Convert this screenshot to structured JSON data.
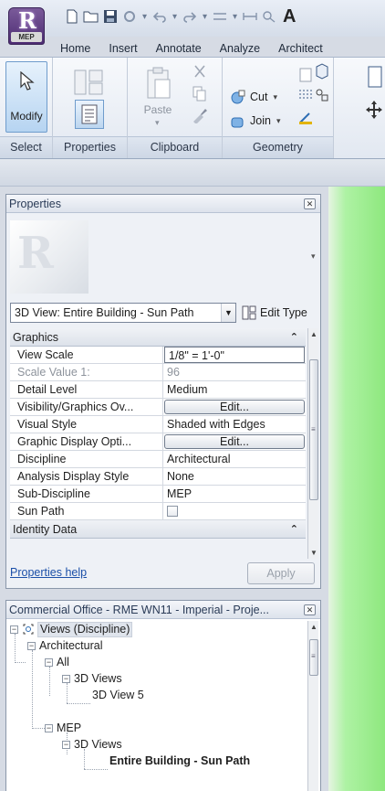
{
  "app": {
    "badge": "MEP",
    "qat_letter": "A"
  },
  "ribbon": {
    "tabs": [
      "Home",
      "Insert",
      "Annotate",
      "Analyze",
      "Architect"
    ],
    "panels": {
      "select": {
        "label": "Select",
        "modify": "Modify"
      },
      "properties": {
        "label": "Properties"
      },
      "clipboard": {
        "label": "Clipboard",
        "paste": "Paste"
      },
      "geometry": {
        "label": "Geometry",
        "cut": "Cut",
        "join": "Join"
      }
    }
  },
  "properties": {
    "title": "Properties",
    "type_selector": "3D View: Entire Building - Sun Path",
    "edit_type": "Edit Type",
    "groups": [
      {
        "name": "Graphics",
        "rows": [
          {
            "key": "View Scale",
            "value": "1/8\" = 1'-0\""
          },
          {
            "key": "Scale Value    1:",
            "value": "96"
          },
          {
            "key": "Detail Level",
            "value": "Medium"
          },
          {
            "key": "Visibility/Graphics Ov...",
            "value": "Edit..."
          },
          {
            "key": "Visual Style",
            "value": "Shaded with Edges"
          },
          {
            "key": "Graphic Display Opti...",
            "value": "Edit..."
          },
          {
            "key": "Discipline",
            "value": "Architectural"
          },
          {
            "key": "Analysis Display Style",
            "value": "None"
          },
          {
            "key": "Sub-Discipline",
            "value": "MEP"
          },
          {
            "key": "Sun Path",
            "value": ""
          }
        ]
      },
      {
        "name": "Identity Data"
      }
    ],
    "help_link": "Properties help",
    "apply": "Apply"
  },
  "browser": {
    "title": "Commercial Office - RME WN11 - Imperial - Proje...",
    "tree": {
      "root": "Views (Discipline)",
      "architectural": "Architectural",
      "all": "All",
      "all_3d": "3D Views",
      "view5": "3D View 5",
      "mep": "MEP",
      "mep_3d": "3D Views",
      "selected_view": "Entire Building - Sun Path"
    }
  }
}
